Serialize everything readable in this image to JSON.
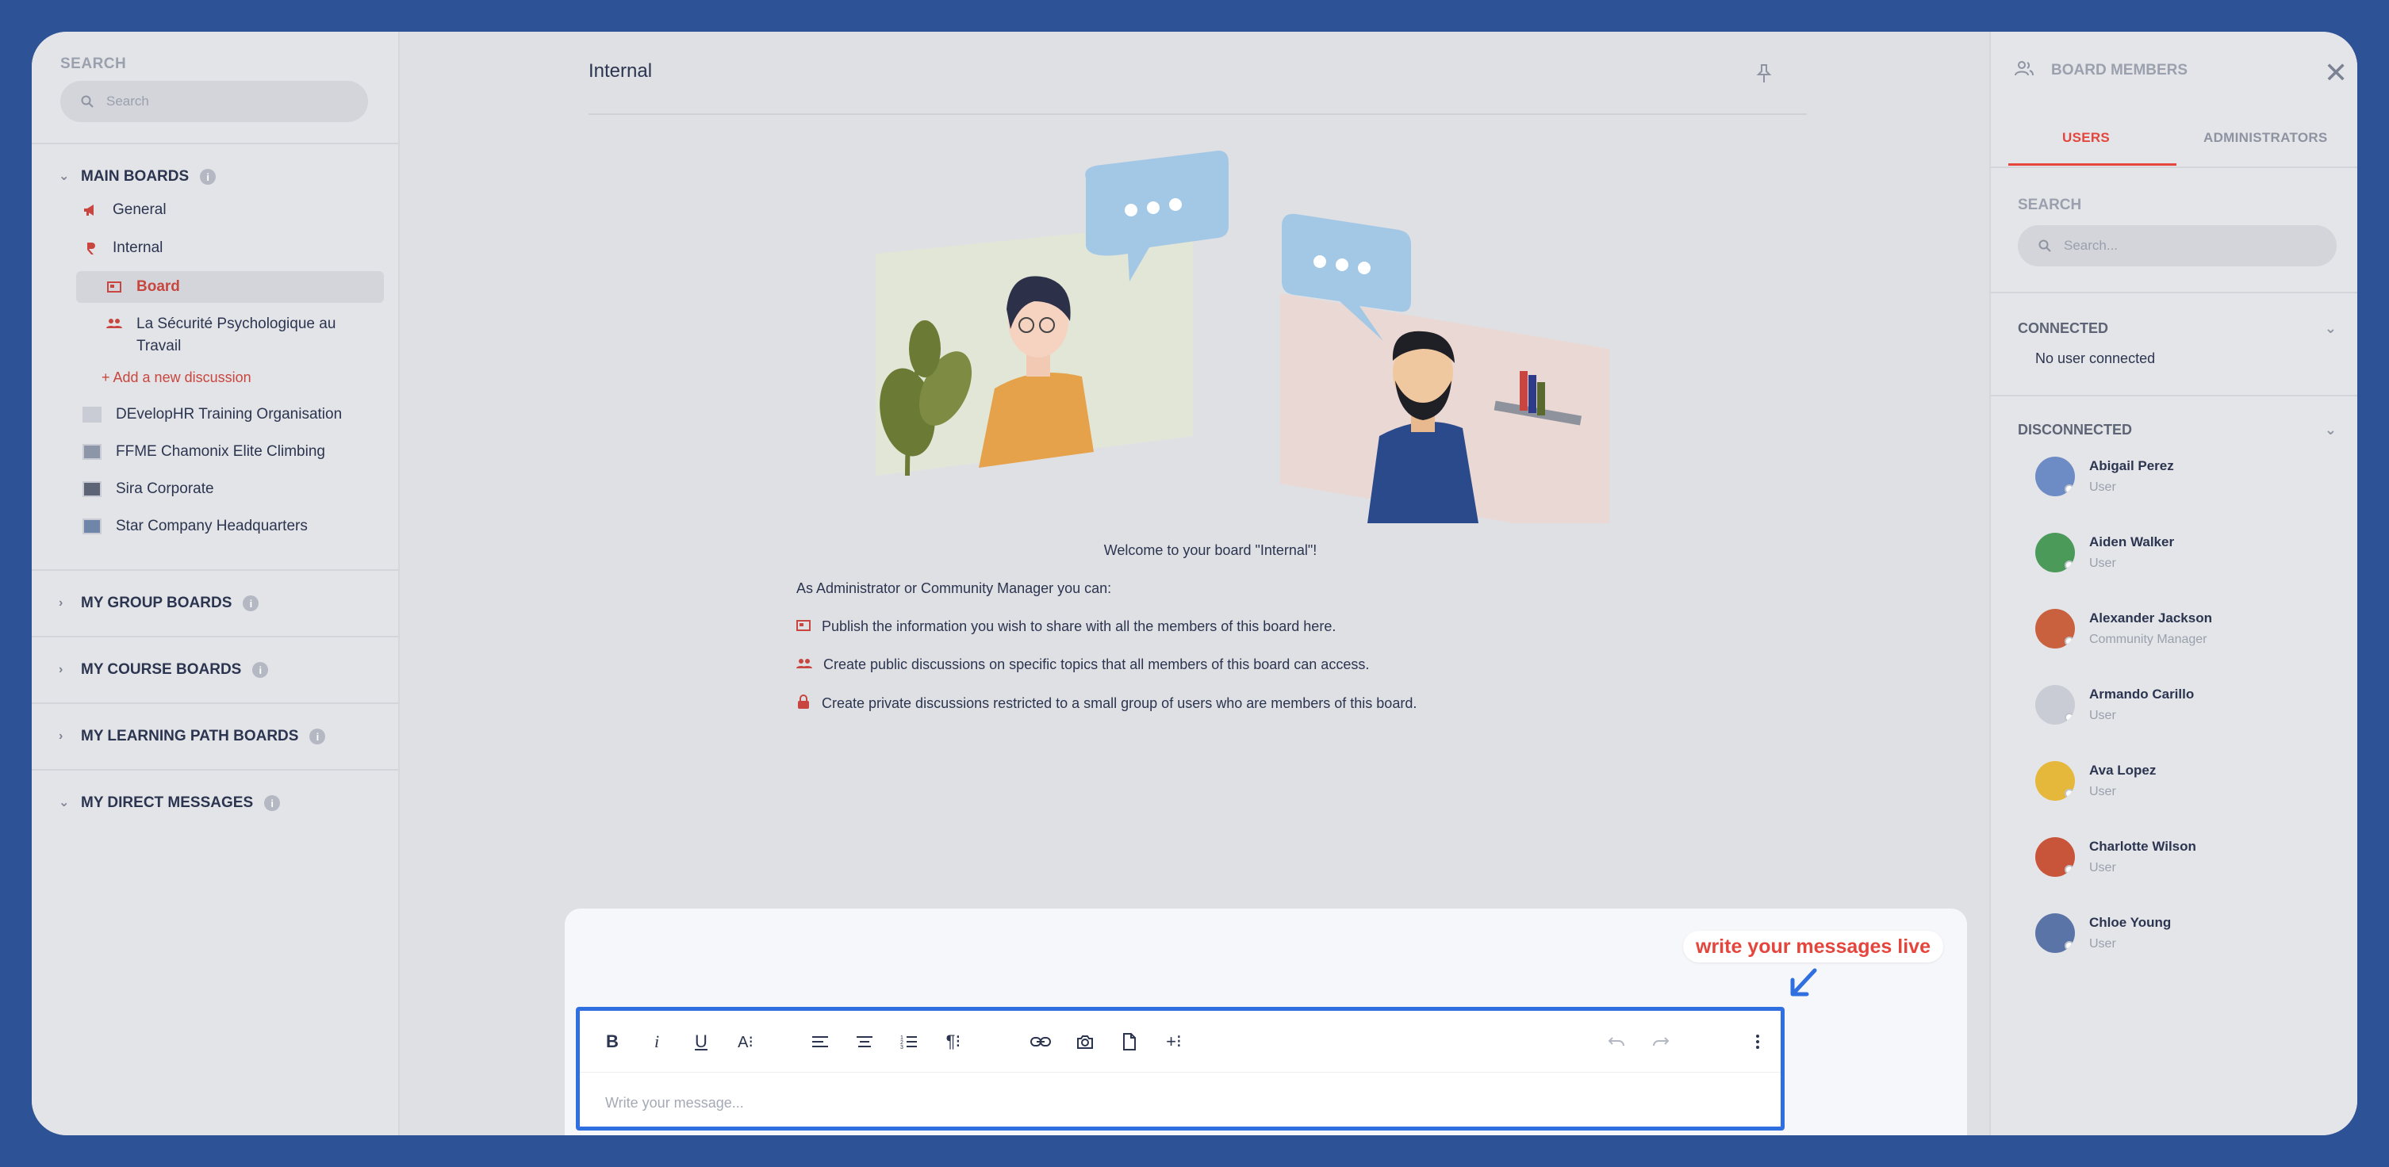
{
  "sidebar": {
    "search_label": "SEARCH",
    "search_placeholder": "Search",
    "sections": {
      "main_boards": "MAIN BOARDS",
      "group_boards": "MY GROUP BOARDS",
      "course_boards": "MY COURSE BOARDS",
      "learning_path_boards": "MY LEARNING PATH BOARDS",
      "direct_messages": "MY DIRECT MESSAGES"
    },
    "main_items": {
      "general": "General",
      "internal": "Internal",
      "board": "Board",
      "discussion": "La Sécurité Psychologique au",
      "discussion_line2": "Travail",
      "add_discussion": "+ Add a new discussion"
    },
    "orgs": [
      "DEvelopHR Training Organisation",
      "FFME Chamonix Elite Climbing",
      "Sira Corporate",
      "Star Company Headquarters"
    ]
  },
  "main": {
    "title": "Internal",
    "welcome": "Welcome to your board \"Internal\"!",
    "intro": "As Administrator or Community Manager you can:",
    "bullets": [
      "Publish the information you wish to share with all the members of this board here.",
      "Create public discussions on specific topics that all members of this board can access.",
      "Create private discussions restricted to a small group of users who are members of this board."
    ],
    "composer": {
      "hint": "write your messages live",
      "placeholder": "Write your message..."
    }
  },
  "members_panel": {
    "title": "BOARD MEMBERS",
    "tabs": [
      "USERS",
      "ADMINISTRATORS"
    ],
    "search_label": "SEARCH",
    "search_placeholder": "Search...",
    "connected_label": "CONNECTED",
    "connected_note": "No user connected",
    "disconnected_label": "DISCONNECTED",
    "members": [
      {
        "name": "Abigail Perez",
        "role": "User"
      },
      {
        "name": "Aiden Walker",
        "role": "User"
      },
      {
        "name": "Alexander Jackson",
        "role": "Community Manager"
      },
      {
        "name": "Armando Carillo",
        "role": "User"
      },
      {
        "name": "Ava Lopez",
        "role": "User"
      },
      {
        "name": "Charlotte Wilson",
        "role": "User"
      },
      {
        "name": "Chloe Young",
        "role": "User"
      }
    ]
  },
  "colors": {
    "accent": "#e4453c",
    "highlight_border": "#2f6fe0",
    "background": "#2d5396"
  }
}
